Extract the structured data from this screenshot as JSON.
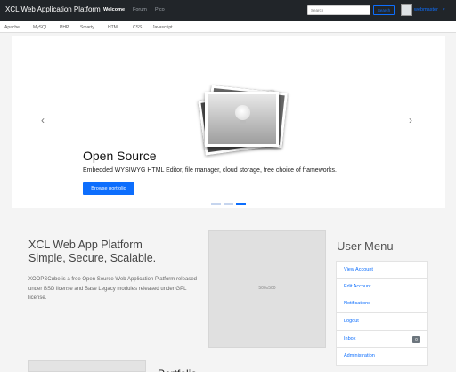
{
  "header": {
    "brand": "XCL Web Application Platform",
    "nav": [
      {
        "label": "Welcome",
        "active": true
      },
      {
        "label": "Forum",
        "active": false
      },
      {
        "label": "Pico",
        "active": false
      }
    ],
    "search": {
      "placeholder": "Search",
      "button": "Search"
    },
    "user": {
      "name": "webmaster"
    }
  },
  "subnav": [
    "Apache",
    "MySQL",
    "PHP",
    "Smarty",
    "HTML",
    "CSS",
    "Javascript"
  ],
  "carousel": {
    "title": "Open Source",
    "text": "Embedded WYSIWYG HTML Editor, file manager, cloud storage, free choice of frameworks.",
    "button": "Browse portfolio",
    "slide_count": 3,
    "active_slide": 3
  },
  "hero": {
    "title_line1": "XCL Web App Platform",
    "title_line2": "Simple, Secure, Scalable.",
    "text": "XOOPSCube is a free Open Source Web Application Platform released under BSD license and Base Legacy modules released under GPL license.",
    "image_placeholder": "500x500"
  },
  "user_menu": {
    "title": "User Menu",
    "items": [
      {
        "label": "View Account"
      },
      {
        "label": "Edit Account"
      },
      {
        "label": "Notifications"
      },
      {
        "label": "Logout"
      },
      {
        "label": "Inbox",
        "badge": "0"
      },
      {
        "label": "Administration"
      }
    ]
  },
  "colors": {
    "navbar": "#212529",
    "accent": "#0d6efd",
    "badge": "#6c757d"
  }
}
